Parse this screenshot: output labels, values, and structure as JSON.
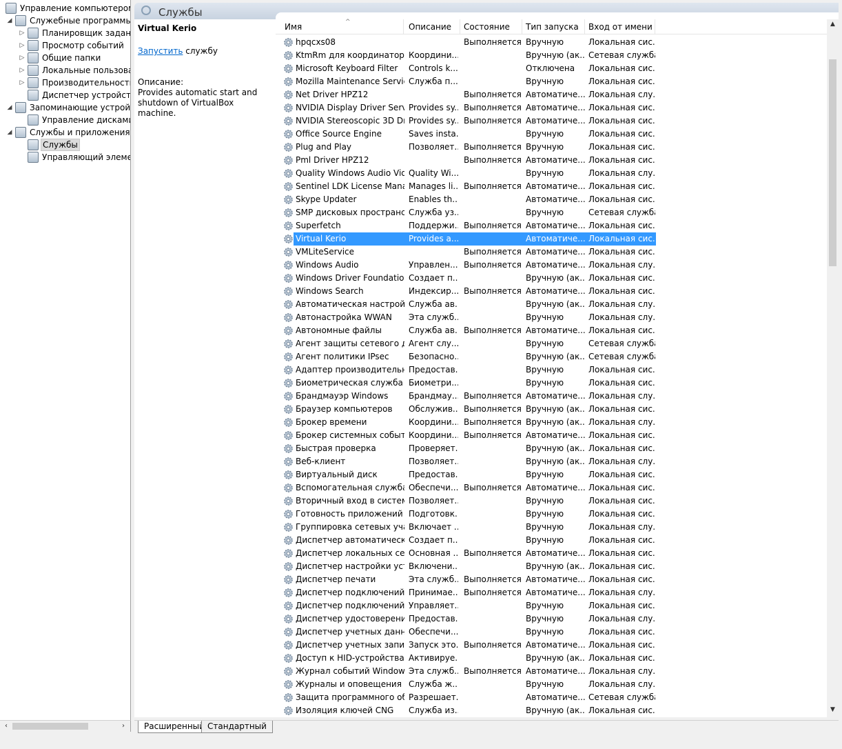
{
  "tree": {
    "items": [
      {
        "label": "Управление компьютером (л",
        "arrow": "",
        "icon": "computer-management-icon",
        "depth": 0
      },
      {
        "label": "Служебные программы",
        "arrow": "◢",
        "icon": "tools-icon",
        "depth": 1
      },
      {
        "label": "Планировщик заданий",
        "arrow": "▷",
        "icon": "task-scheduler-icon",
        "depth": 2
      },
      {
        "label": "Просмотр событий",
        "arrow": "▷",
        "icon": "event-viewer-icon",
        "depth": 2
      },
      {
        "label": "Общие папки",
        "arrow": "▷",
        "icon": "shared-folders-icon",
        "depth": 2
      },
      {
        "label": "Локальные пользовате",
        "arrow": "▷",
        "icon": "local-users-icon",
        "depth": 2
      },
      {
        "label": "Производительность",
        "arrow": "▷",
        "icon": "performance-icon",
        "depth": 2
      },
      {
        "label": "Диспетчер устройств",
        "arrow": "",
        "icon": "device-manager-icon",
        "depth": 2
      },
      {
        "label": "Запоминающие устройст",
        "arrow": "◢",
        "icon": "storage-icon",
        "depth": 1
      },
      {
        "label": "Управление дисками",
        "arrow": "",
        "icon": "disk-management-icon",
        "depth": 2
      },
      {
        "label": "Службы и приложения",
        "arrow": "◢",
        "icon": "services-apps-icon",
        "depth": 1
      },
      {
        "label": "Службы",
        "arrow": "",
        "icon": "services-icon",
        "depth": 2,
        "selected": true
      },
      {
        "label": "Управляющий элемен",
        "arrow": "",
        "icon": "wmi-control-icon",
        "depth": 2
      }
    ]
  },
  "header": {
    "title": "Службы"
  },
  "desc": {
    "service_name": "Virtual Kerio",
    "start_link": "Запустить",
    "start_suffix": " службу",
    "desc_label": "Описание:",
    "desc_text": "Provides automatic start and shutdown of VirtualBox machine."
  },
  "columns": [
    "Имя",
    "Описание",
    "Состояние",
    "Тип запуска",
    "Вход от имени"
  ],
  "rows": [
    [
      "hpqcxs08",
      "",
      "Выполняется",
      "Вручную",
      "Локальная сис..."
    ],
    [
      "KtmRm для координатора ...",
      "Координи...",
      "",
      "Вручную (ак...",
      "Сетевая служба"
    ],
    [
      "Microsoft Keyboard Filter",
      "Controls k...",
      "",
      "Отключена",
      "Локальная сис..."
    ],
    [
      "Mozilla Maintenance Service",
      "Служба п...",
      "",
      "Вручную",
      "Локальная сис..."
    ],
    [
      "Net Driver HPZ12",
      "",
      "Выполняется",
      "Автоматиче...",
      "Локальная слу..."
    ],
    [
      "NVIDIA Display Driver Service",
      "Provides sy...",
      "Выполняется",
      "Автоматиче...",
      "Локальная сис..."
    ],
    [
      "NVIDIA Stereoscopic 3D Dri...",
      "Provides sy...",
      "Выполняется",
      "Автоматиче...",
      "Локальная сис..."
    ],
    [
      "Office  Source Engine",
      "Saves insta...",
      "",
      "Вручную",
      "Локальная сис..."
    ],
    [
      "Plug and Play",
      "Позволяет...",
      "Выполняется",
      "Вручную",
      "Локальная сис..."
    ],
    [
      "Pml Driver HPZ12",
      "",
      "Выполняется",
      "Автоматиче...",
      "Локальная сис..."
    ],
    [
      "Quality Windows Audio Vid...",
      "Quality Wi...",
      "",
      "Вручную",
      "Локальная слу..."
    ],
    [
      "Sentinel LDK License Mana...",
      "Manages li...",
      "Выполняется",
      "Автоматиче...",
      "Локальная сис..."
    ],
    [
      "Skype Updater",
      "Enables th...",
      "",
      "Автоматиче...",
      "Локальная сис..."
    ],
    [
      "SMP дисковых пространст...",
      "Служба уз...",
      "",
      "Вручную",
      "Сетевая служба"
    ],
    [
      "Superfetch",
      "Поддержи...",
      "Выполняется",
      "Автоматиче...",
      "Локальная сис..."
    ],
    [
      "Virtual Kerio",
      "Provides a...",
      "",
      "Автоматиче...",
      "Локальная сис..."
    ],
    [
      "VMLiteService",
      "",
      "Выполняется",
      "Автоматиче...",
      "Локальная сис..."
    ],
    [
      "Windows Audio",
      "Управлен...",
      "Выполняется",
      "Автоматиче...",
      "Локальная слу..."
    ],
    [
      "Windows Driver Foundation...",
      "Создает п...",
      "",
      "Вручную (ак...",
      "Локальная сис..."
    ],
    [
      "Windows Search",
      "Индексир...",
      "Выполняется",
      "Автоматиче...",
      "Локальная сис..."
    ],
    [
      "Автоматическая настройк...",
      "Служба ав...",
      "",
      "Вручную (ак...",
      "Локальная слу..."
    ],
    [
      "Автонастройка WWAN",
      "Эта служб...",
      "",
      "Вручную",
      "Локальная слу..."
    ],
    [
      "Автономные файлы",
      "Служба ав...",
      "Выполняется",
      "Автоматиче...",
      "Локальная сис..."
    ],
    [
      "Агент защиты сетевого до...",
      "Агент слу...",
      "",
      "Вручную",
      "Сетевая служба"
    ],
    [
      "Агент политики IPsec",
      "Безопасно...",
      "",
      "Вручную (ак...",
      "Сетевая служба"
    ],
    [
      "Адаптер производительно...",
      "Предостав...",
      "",
      "Вручную",
      "Локальная сис..."
    ],
    [
      "Биометрическая служба ...",
      "Биометри...",
      "",
      "Вручную",
      "Локальная сис..."
    ],
    [
      "Брандмауэр Windows",
      "Брандмау...",
      "Выполняется",
      "Автоматиче...",
      "Локальная слу..."
    ],
    [
      "Браузер компьютеров",
      "Обслужив...",
      "Выполняется",
      "Вручную (ак...",
      "Локальная сис..."
    ],
    [
      "Брокер времени",
      "Координи...",
      "Выполняется",
      "Вручную (ак...",
      "Локальная слу..."
    ],
    [
      "Брокер системных событий",
      "Координи...",
      "Выполняется",
      "Автоматиче...",
      "Локальная сис..."
    ],
    [
      "Быстрая проверка",
      "Проверяет...",
      "",
      "Вручную (ак...",
      "Локальная сис..."
    ],
    [
      "Веб-клиент",
      "Позволяет...",
      "",
      "Вручную (ак...",
      "Локальная слу..."
    ],
    [
      "Виртуальный диск",
      "Предостав...",
      "",
      "Вручную",
      "Локальная сис..."
    ],
    [
      "Вспомогательная служба IP",
      "Обеспечи...",
      "Выполняется",
      "Автоматиче...",
      "Локальная сис..."
    ],
    [
      "Вторичный вход в систему",
      "Позволяет...",
      "",
      "Вручную",
      "Локальная сис..."
    ],
    [
      "Готовность приложений",
      "Подготовк...",
      "",
      "Вручную",
      "Локальная сис..."
    ],
    [
      "Группировка сетевых учас...",
      "Включает ...",
      "",
      "Вручную",
      "Локальная слу..."
    ],
    [
      "Диспетчер автоматически...",
      "Создает п...",
      "",
      "Вручную",
      "Локальная сис..."
    ],
    [
      "Диспетчер локальных сеа...",
      "Основная ...",
      "Выполняется",
      "Автоматиче...",
      "Локальная сис..."
    ],
    [
      "Диспетчер настройки устр...",
      "Включени...",
      "",
      "Вручную (ак...",
      "Локальная сис..."
    ],
    [
      "Диспетчер печати",
      "Эта служб...",
      "Выполняется",
      "Автоматиче...",
      "Локальная сис..."
    ],
    [
      "Диспетчер подключений ...",
      "Принимае...",
      "Выполняется",
      "Автоматиче...",
      "Локальная слу..."
    ],
    [
      "Диспетчер подключений ...",
      "Управляет...",
      "",
      "Вручную",
      "Локальная сис..."
    ],
    [
      "Диспетчер удостоверения ...",
      "Предостав...",
      "",
      "Вручную",
      "Локальная слу..."
    ],
    [
      "Диспетчер учетных данных",
      "Обеспечи...",
      "",
      "Вручную",
      "Локальная сис..."
    ],
    [
      "Диспетчер учетных записе...",
      "Запуск это...",
      "Выполняется",
      "Автоматиче...",
      "Локальная сис..."
    ],
    [
      "Доступ к HID-устройствам",
      "Активируе...",
      "",
      "Вручную (ак...",
      "Локальная сис..."
    ],
    [
      "Журнал событий Windows",
      "Эта служб...",
      "Выполняется",
      "Автоматиче...",
      "Локальная слу..."
    ],
    [
      "Журналы и оповещения п...",
      "Служба ж...",
      "",
      "Вручную",
      "Локальная слу..."
    ],
    [
      "Защита программного об...",
      "Разрешает...",
      "",
      "Автоматиче...",
      "Сетевая служба"
    ],
    [
      "Изоляция ключей CNG",
      "Служба из...",
      "",
      "Вручную (ак...",
      "Локальная сис..."
    ]
  ],
  "selected_row": 15,
  "tabs": [
    "Расширенный",
    "Стандартный"
  ],
  "colors": {
    "selection": "#3399ff",
    "link": "#0066cc"
  }
}
